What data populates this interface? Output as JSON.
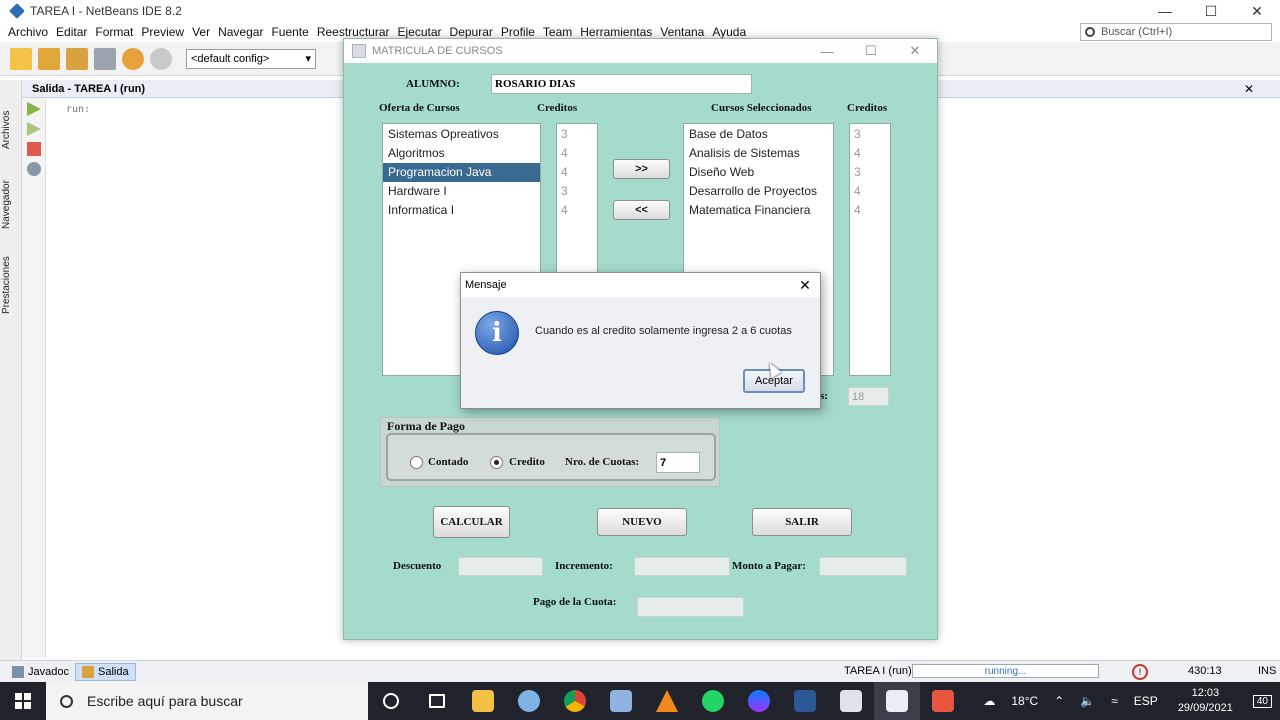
{
  "ide": {
    "title": "TAREA I - NetBeans IDE 8.2",
    "menu": [
      "Archivo",
      "Editar",
      "Format",
      "Preview",
      "Ver",
      "Navegar",
      "Fuente",
      "Reestructurar",
      "Ejecutar",
      "Depurar",
      "Profile",
      "Team",
      "Herramientas",
      "Ventana",
      "Ayuda"
    ],
    "search_placeholder": "Buscar (Ctrl+I)",
    "config": "<default config>",
    "side_tabs": [
      "Archivos",
      "Navegador",
      "Prestaciones"
    ],
    "output_title": "Salida - TAREA I (run)",
    "output_text": "run:",
    "status": {
      "tab_javadoc": "Javadoc",
      "tab_salida": "Salida",
      "project": "TAREA I (run)",
      "progress": "running...",
      "position": "430:13",
      "mode": "INS"
    },
    "colors": {
      "accent": "#3a6a8f",
      "form_bg": "#a4dbcd"
    }
  },
  "matricula": {
    "title": "MATRICULA DE CURSOS",
    "alumno_label": "ALUMNO:",
    "alumno_value": "ROSARIO DIAS",
    "oferta_label": "Oferta de Cursos",
    "creditos_label": "Creditos",
    "seleccionados_label": "Cursos Seleccionados",
    "creditos_label_2": "Creditos",
    "oferta": [
      {
        "nombre": "Sistemas Opreativos",
        "creditos": "3"
      },
      {
        "nombre": "Algoritmos",
        "creditos": "4"
      },
      {
        "nombre": "Programacion Java",
        "creditos": "4"
      },
      {
        "nombre": "Hardware I",
        "creditos": "3"
      },
      {
        "nombre": "Informatica I",
        "creditos": "4"
      }
    ],
    "selected_index": 2,
    "seleccionados": [
      {
        "nombre": "Base de Datos",
        "creditos": "3"
      },
      {
        "nombre": "Analisis de Sistemas",
        "creditos": "4"
      },
      {
        "nombre": "Diseño Web",
        "creditos": "3"
      },
      {
        "nombre": "Desarrollo de Proyectos",
        "creditos": "4"
      },
      {
        "nombre": "Matematica Financiera",
        "creditos": "4"
      }
    ],
    "btn_add": ">>",
    "btn_remove": "<<",
    "total_label_tail": "s:",
    "total_value": "18",
    "forma_pago_title": "Forma de Pago",
    "contado_label": "Contado",
    "credito_label": "Credito",
    "cuotas_label": "Nro. de Cuotas:",
    "cuotas_value": "7",
    "btn_calcular": "CALCULAR",
    "btn_nuevo": "NUEVO",
    "btn_salir": "SALIR",
    "descuento_label": "Descuento",
    "incremento_label": "Incremento:",
    "monto_label": "Monto a Pagar:",
    "pago_cuota_label": "Pago de la Cuota:"
  },
  "dialog": {
    "title": "Mensaje",
    "message": "Cuando es al credito solamente ingresa 2 a 6 cuotas",
    "ok_label": "Aceptar",
    "icon": "info-icon"
  },
  "taskbar": {
    "search_placeholder": "Escribe aquí para buscar",
    "temperature": "18°C",
    "language": "ESP",
    "time": "12:03",
    "date": "29/09/2021",
    "notifications": "40"
  }
}
